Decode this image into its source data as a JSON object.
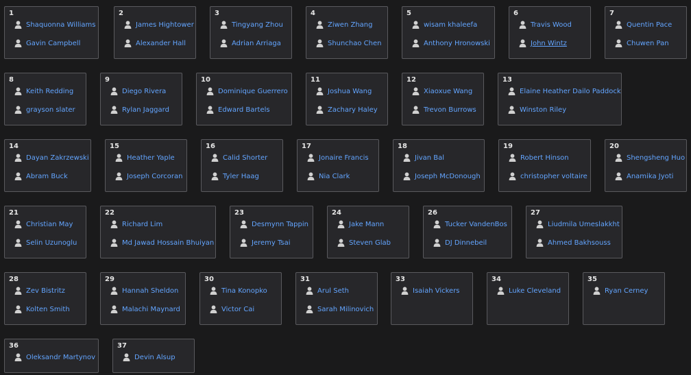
{
  "colors": {
    "background": "#1a1a1b",
    "card": "#27272a",
    "border": "#5a5a5e",
    "name": "#63a5ff",
    "number": "#e6e6e6",
    "icon": "#d0d0d0"
  },
  "icon": "person-icon",
  "teams": [
    {
      "number": "1",
      "members": [
        "Shaquonna Williams",
        "Gavin Campbell"
      ]
    },
    {
      "number": "2",
      "members": [
        "James Hightower",
        "Alexander Hall"
      ]
    },
    {
      "number": "3",
      "members": [
        "Tingyang Zhou",
        "Adrian Arriaga"
      ]
    },
    {
      "number": "4",
      "members": [
        "Ziwen Zhang",
        "Shunchao Chen"
      ]
    },
    {
      "number": "5",
      "members": [
        "wisam khaleefa",
        "Anthony Hronowski"
      ]
    },
    {
      "number": "6",
      "members": [
        "Travis Wood",
        "John Wintz"
      ],
      "underlined_member": "John Wintz"
    },
    {
      "number": "7",
      "members": [
        "Quentin Pace",
        "Chuwen Pan"
      ]
    },
    {
      "number": "8",
      "members": [
        "Keith Redding",
        "grayson slater"
      ]
    },
    {
      "number": "9",
      "members": [
        "Diego Rivera",
        "Rylan Jaggard"
      ]
    },
    {
      "number": "10",
      "members": [
        "Dominique Guerrero",
        "Edward Bartels"
      ]
    },
    {
      "number": "11",
      "members": [
        "Joshua Wang",
        "Zachary Haley"
      ]
    },
    {
      "number": "12",
      "members": [
        "Xiaoxue Wang",
        "Trevon Burrows"
      ]
    },
    {
      "number": "13",
      "members": [
        "Elaine Heather Dailo Paddock",
        "Winston Riley"
      ]
    },
    {
      "number": "14",
      "members": [
        "Dayan Zakrzewski",
        "Abram Buck"
      ]
    },
    {
      "number": "15",
      "members": [
        "Heather Yaple",
        "Joseph Corcoran"
      ]
    },
    {
      "number": "16",
      "members": [
        "Calid Shorter",
        "Tyler Haag"
      ]
    },
    {
      "number": "17",
      "members": [
        "Jonaire Francis",
        "Nia Clark"
      ]
    },
    {
      "number": "18",
      "members": [
        "Jivan Bal",
        "Joseph McDonough"
      ]
    },
    {
      "number": "19",
      "members": [
        "Robert Hinson",
        "christopher voltaire"
      ]
    },
    {
      "number": "20",
      "members": [
        "Shengsheng Huo",
        "Anamika Jyoti"
      ]
    },
    {
      "number": "21",
      "members": [
        "Christian May",
        "Selin Uzunoglu"
      ]
    },
    {
      "number": "22",
      "members": [
        "Richard Lim",
        "Md Jawad Hossain Bhuiyan"
      ]
    },
    {
      "number": "23",
      "members": [
        "Desmynn Tappin",
        "Jeremy Tsai"
      ]
    },
    {
      "number": "24",
      "members": [
        "Jake Mann",
        "Steven Glab"
      ]
    },
    {
      "number": "26",
      "members": [
        "Tucker VandenBos",
        "DJ Dinnebeil"
      ]
    },
    {
      "number": "27",
      "members": [
        "Liudmila Umeslakkht",
        "Ahmed Bakhsouss"
      ]
    },
    {
      "number": "28",
      "members": [
        "Zev Bistritz",
        "Kolten Smith"
      ]
    },
    {
      "number": "29",
      "members": [
        "Hannah Sheldon",
        "Malachi Maynard"
      ]
    },
    {
      "number": "30",
      "members": [
        "Tina Konopko",
        "Victor Cai"
      ]
    },
    {
      "number": "31",
      "members": [
        "Arul Seth",
        "Sarah Milinovich"
      ]
    },
    {
      "number": "33",
      "members": [
        "Isaiah Vickers"
      ]
    },
    {
      "number": "34",
      "members": [
        "Luke Cleveland"
      ]
    },
    {
      "number": "35",
      "members": [
        "Ryan Cerney"
      ]
    },
    {
      "number": "36",
      "members": [
        "Oleksandr Martynov"
      ]
    },
    {
      "number": "37",
      "members": [
        "Devin Alsup"
      ]
    }
  ]
}
